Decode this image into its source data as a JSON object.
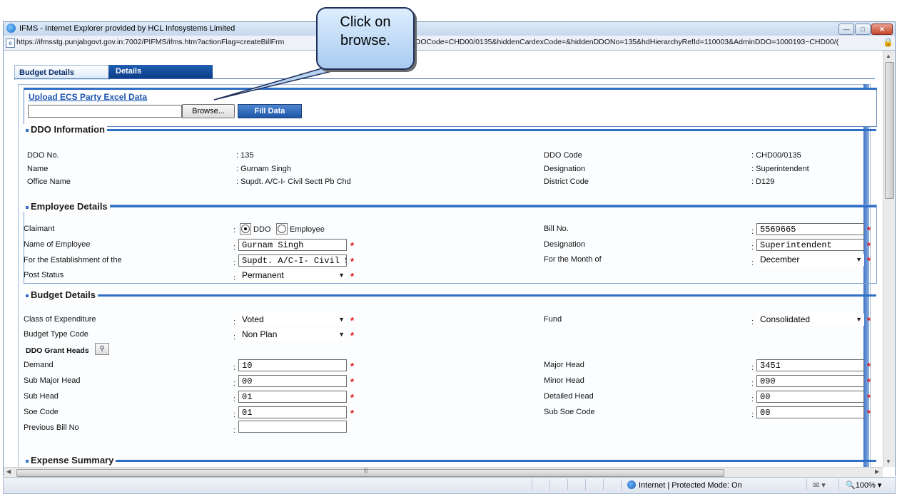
{
  "window": {
    "title": "IFMS - Internet Explorer provided by HCL Infosystems Limited",
    "url": "https://ifmsstg.punjabgovt.gov.in:7002/PIFMS/ifms.htm?actionFlag=createBillFrm",
    "url_tail": "hDDOCode=CHD00/0135&hiddenCardexCode=&hiddenDDONo=135&hdHierarchyRefId=110003&AdminDDO=1000193~CHD00/("
  },
  "callout": {
    "line1": "Click on",
    "line2": "browse."
  },
  "tabs": {
    "budget_details": "Budget Details",
    "details": "Details"
  },
  "upload": {
    "link": "Upload ECS Party Excel Data",
    "browse": "Browse...",
    "fill_data": "Fill Data"
  },
  "ddo_info": {
    "title": "DDO Information",
    "ddo_no_label": "DDO No.",
    "ddo_no": ": 135",
    "name_label": "Name",
    "name": ": Gurnam Singh",
    "office_label": "Office Name",
    "office": ": Supdt. A/C-I- Civil Sectt Pb Chd",
    "ddo_code_label": "DDO Code",
    "ddo_code": ": CHD00/0135",
    "designation_label": "Designation",
    "designation": ": Superintendent",
    "district_label": "District Code",
    "district": ": D129"
  },
  "employee": {
    "title": "Employee Details",
    "claimant_label": "Claimant",
    "claimant_ddo": "DDO",
    "claimant_employee": "Employee",
    "name_label": "Name of Employee",
    "name_value": "Gurnam  Singh",
    "establishment_label": "For the Establishment of the",
    "establishment_value": "Supdt. A/C-I- Civil Sectt",
    "post_status_label": "Post Status",
    "post_status_value": "Permanent",
    "bill_no_label": "Bill No.",
    "bill_no_value": "5569665",
    "designation_label": "Designation",
    "designation_value": "Superintendent",
    "month_label": "For the Month of",
    "month_value": "December"
  },
  "budget": {
    "title": "Budget Details",
    "class_label": "Class of Expenditure",
    "class_value": "Voted",
    "type_label": "Budget Type Code",
    "type_value": "Non Plan",
    "grant_heads_label": "DDO Grant Heads",
    "demand_label": "Demand",
    "demand_value": "10",
    "sub_major_label": "Sub Major Head",
    "sub_major_value": "00",
    "sub_head_label": "Sub Head",
    "sub_head_value": "01",
    "soe_label": "Soe Code",
    "soe_value": "01",
    "prev_bill_label": "Previous Bill No",
    "prev_bill_value": "",
    "fund_label": "Fund",
    "fund_value": "Consolidated",
    "major_label": "Major Head",
    "major_value": "3451",
    "minor_label": "Minor Head",
    "minor_value": "090",
    "detailed_label": "Detailed Head",
    "detailed_value": "00",
    "sub_soe_label": "Sub Soe Code",
    "sub_soe_value": "00"
  },
  "expense": {
    "title": "Expense Summary"
  },
  "status": {
    "zone": "Internet | Protected Mode: On",
    "zoom": "100%"
  }
}
